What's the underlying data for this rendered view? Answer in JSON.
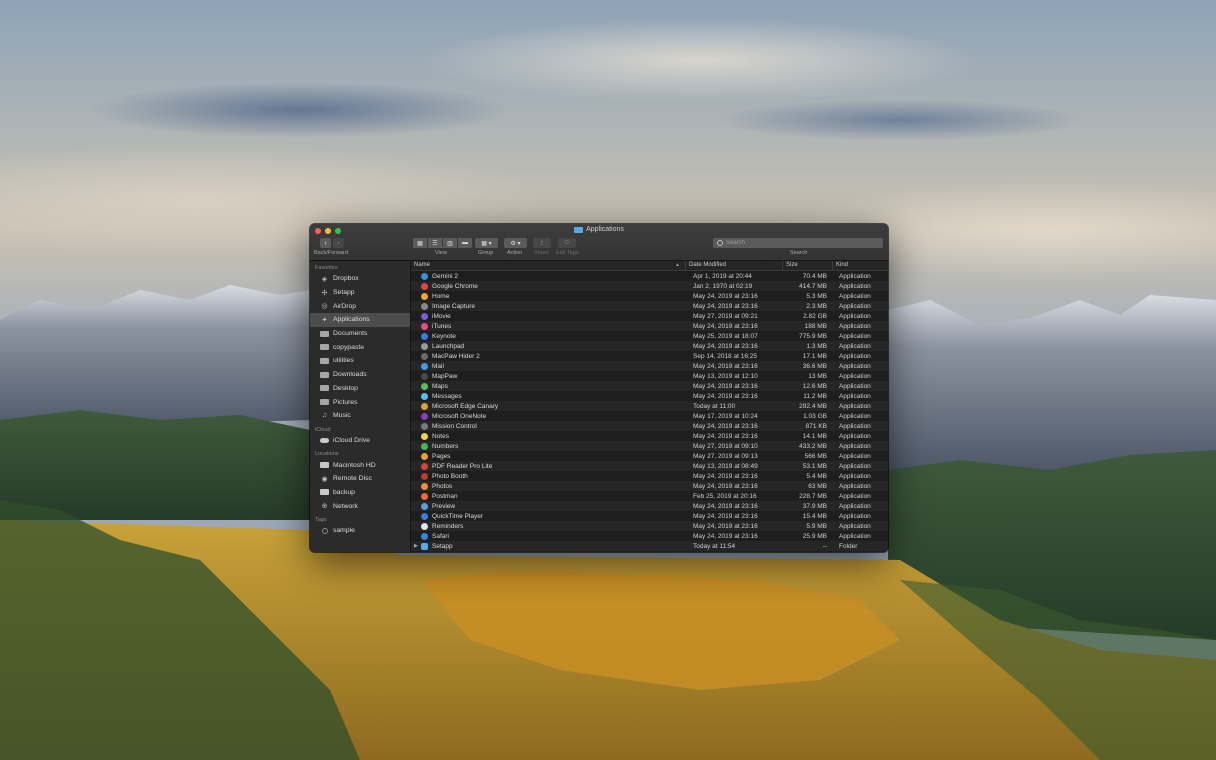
{
  "window": {
    "title": "Applications"
  },
  "toolbar": {
    "back_forward_label": "Back/Forward",
    "view_label": "View",
    "group_label": "Group",
    "action_label": "Action",
    "share_label": "Share",
    "edit_tags_label": "Edit Tags",
    "search_label": "Search",
    "search_placeholder": "Search"
  },
  "sidebar": {
    "favorites_header": "Favorites",
    "favorites": [
      {
        "label": "Dropbox",
        "icon": "dropbox-icon"
      },
      {
        "label": "Setapp",
        "icon": "setapp-icon"
      },
      {
        "label": "AirDrop",
        "icon": "airdrop-icon"
      },
      {
        "label": "Applications",
        "icon": "applications-icon",
        "active": true
      },
      {
        "label": "Documents",
        "icon": "documents-icon"
      },
      {
        "label": "copypaste",
        "icon": "folder-icon"
      },
      {
        "label": "utilities",
        "icon": "folder-icon"
      },
      {
        "label": "Downloads",
        "icon": "downloads-icon"
      },
      {
        "label": "Desktop",
        "icon": "desktop-icon"
      },
      {
        "label": "Pictures",
        "icon": "pictures-icon"
      },
      {
        "label": "Music",
        "icon": "music-icon"
      }
    ],
    "icloud_header": "iCloud",
    "icloud": [
      {
        "label": "iCloud Drive",
        "icon": "cloud-icon"
      }
    ],
    "locations_header": "Locations",
    "locations": [
      {
        "label": "Macintosh HD",
        "icon": "disk-icon"
      },
      {
        "label": "Remote Disc",
        "icon": "disc-icon"
      },
      {
        "label": "backup",
        "icon": "disk-icon"
      },
      {
        "label": "Network",
        "icon": "network-icon"
      }
    ],
    "tags_header": "Tags",
    "tags": [
      {
        "label": "sample",
        "icon": "tag-dot-icon"
      }
    ]
  },
  "list": {
    "columns": {
      "name": "Name",
      "date": "Date Modified",
      "size": "Size",
      "kind": "Kind"
    },
    "rows": [
      {
        "name": "Gemini 2",
        "date": "Apr 1, 2019 at 20:44",
        "size": "70.4 MB",
        "kind": "Application",
        "color": "#3a8fd8"
      },
      {
        "name": "Google Chrome",
        "date": "Jan 2, 1970 at 02:19",
        "size": "414.7 MB",
        "kind": "Application",
        "color": "#e8453c"
      },
      {
        "name": "Home",
        "date": "May 24, 2019 at 23:16",
        "size": "5.3 MB",
        "kind": "Application",
        "color": "#f5a623"
      },
      {
        "name": "Image Capture",
        "date": "May 24, 2019 at 23:16",
        "size": "2.3 MB",
        "kind": "Application",
        "color": "#8a8a8a"
      },
      {
        "name": "iMovie",
        "date": "May 27, 2019 at 09:21",
        "size": "2.82 GB",
        "kind": "Application",
        "color": "#7c5cd6"
      },
      {
        "name": "iTunes",
        "date": "May 24, 2019 at 23:16",
        "size": "188 MB",
        "kind": "Application",
        "color": "#e94a8b"
      },
      {
        "name": "Keynote",
        "date": "May 25, 2019 at 18:07",
        "size": "775.9 MB",
        "kind": "Application",
        "color": "#2f7fe0"
      },
      {
        "name": "Launchpad",
        "date": "May 24, 2019 at 23:16",
        "size": "1.3 MB",
        "kind": "Application",
        "color": "#9a9a9a"
      },
      {
        "name": "MacPaw Hider 2",
        "date": "Sep 14, 2018 at 16:25",
        "size": "17.1 MB",
        "kind": "Application",
        "color": "#6b6b6b"
      },
      {
        "name": "Mail",
        "date": "May 24, 2019 at 23:16",
        "size": "36.6 MB",
        "kind": "Application",
        "color": "#3d9be9"
      },
      {
        "name": "MapPaw",
        "date": "May 13, 2019 at 12:10",
        "size": "13 MB",
        "kind": "Application",
        "color": "#4a4a4a"
      },
      {
        "name": "Maps",
        "date": "May 24, 2019 at 23:16",
        "size": "12.6 MB",
        "kind": "Application",
        "color": "#5fbf5a"
      },
      {
        "name": "Messages",
        "date": "May 24, 2019 at 23:16",
        "size": "11.2 MB",
        "kind": "Application",
        "color": "#4fc3f7"
      },
      {
        "name": "Microsoft Edge Canary",
        "date": "Today at 11:00",
        "size": "292.4 MB",
        "kind": "Application",
        "color": "#e0a030"
      },
      {
        "name": "Microsoft OneNote",
        "date": "May 17, 2019 at 10:24",
        "size": "1.03 GB",
        "kind": "Application",
        "color": "#8a3fbf"
      },
      {
        "name": "Mission Control",
        "date": "May 24, 2019 at 23:16",
        "size": "871 KB",
        "kind": "Application",
        "color": "#7a7a7a"
      },
      {
        "name": "Notes",
        "date": "May 24, 2019 at 23:16",
        "size": "14.1 MB",
        "kind": "Application",
        "color": "#f3d34a"
      },
      {
        "name": "Numbers",
        "date": "May 27, 2019 at 09:10",
        "size": "433.2 MB",
        "kind": "Application",
        "color": "#3fb950"
      },
      {
        "name": "Pages",
        "date": "May 27, 2019 at 09:13",
        "size": "566 MB",
        "kind": "Application",
        "color": "#f39c34"
      },
      {
        "name": "PDF Reader Pro Lite",
        "date": "May 13, 2019 at 08:49",
        "size": "53.1 MB",
        "kind": "Application",
        "color": "#d9413a"
      },
      {
        "name": "Photo Booth",
        "date": "May 24, 2019 at 23:16",
        "size": "5.4 MB",
        "kind": "Application",
        "color": "#c0392b"
      },
      {
        "name": "Photos",
        "date": "May 24, 2019 at 23:16",
        "size": "63 MB",
        "kind": "Application",
        "color": "#f08c3c"
      },
      {
        "name": "Postman",
        "date": "Feb 25, 2019 at 20:16",
        "size": "228.7 MB",
        "kind": "Application",
        "color": "#ef6a37"
      },
      {
        "name": "Preview",
        "date": "May 24, 2019 at 23:16",
        "size": "37.9 MB",
        "kind": "Application",
        "color": "#5a9fd6"
      },
      {
        "name": "QuickTime Player",
        "date": "May 24, 2019 at 23:16",
        "size": "15.4 MB",
        "kind": "Application",
        "color": "#3b7dd8"
      },
      {
        "name": "Reminders",
        "date": "May 24, 2019 at 23:16",
        "size": "5.9 MB",
        "kind": "Application",
        "color": "#e5e5e5"
      },
      {
        "name": "Safari",
        "date": "May 24, 2019 at 23:16",
        "size": "25.9 MB",
        "kind": "Application",
        "color": "#2d8ce6"
      },
      {
        "name": "Setapp",
        "date": "Today at 11:54",
        "size": "--",
        "kind": "Folder",
        "color": "#5aa9e6",
        "folder": true
      }
    ]
  }
}
